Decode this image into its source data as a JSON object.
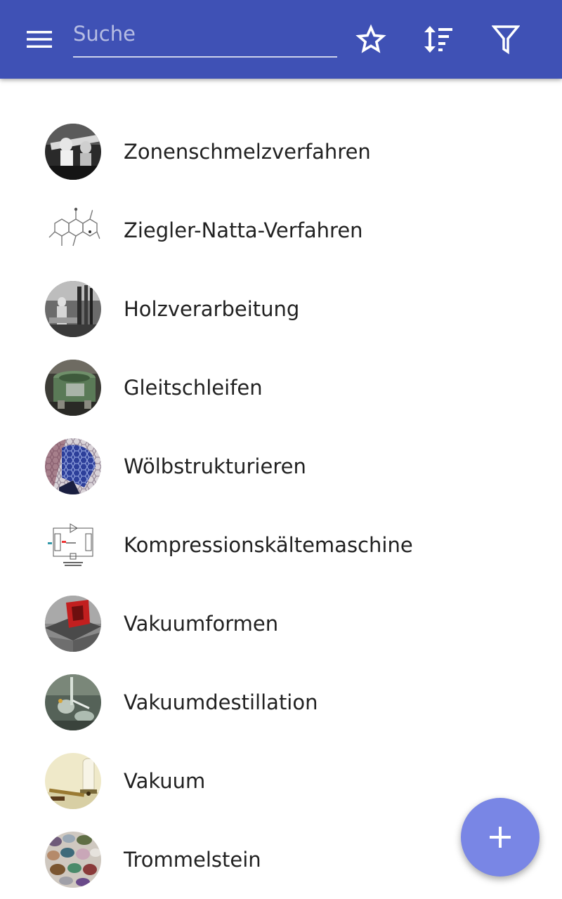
{
  "header": {
    "search": {
      "placeholder": "Suche",
      "value": ""
    },
    "icons": [
      "menu-icon",
      "star-icon",
      "sort-icon",
      "filter-icon"
    ]
  },
  "list": {
    "items": [
      {
        "label": "Zonenschmelzverfahren",
        "thumbnail": "zone-melting-photo"
      },
      {
        "label": "Ziegler-Natta-Verfahren",
        "thumbnail": "chemical-structure-drawing"
      },
      {
        "label": "Holzverarbeitung",
        "thumbnail": "woodworking-photo"
      },
      {
        "label": "Gleitschleifen",
        "thumbnail": "vibratory-finishing-machine-photo"
      },
      {
        "label": "Wölbstrukturieren",
        "thumbnail": "vault-structured-sheet-photo"
      },
      {
        "label": "Kompressionskältemaschine",
        "thumbnail": "refrigeration-cycle-diagram"
      },
      {
        "label": "Vakuumformen",
        "thumbnail": "vacuum-forming-render"
      },
      {
        "label": "Vakuumdestillation",
        "thumbnail": "distillation-glassware-photo"
      },
      {
        "label": "Vakuum",
        "thumbnail": "vacuum-bell-jar-photo"
      },
      {
        "label": "Trommelstein",
        "thumbnail": "tumbled-stones-photo"
      }
    ]
  },
  "fab": {
    "icon": "plus-icon"
  },
  "colors": {
    "appbar": "#3f51b5",
    "fab": "#7986e5",
    "text": "#212121"
  }
}
